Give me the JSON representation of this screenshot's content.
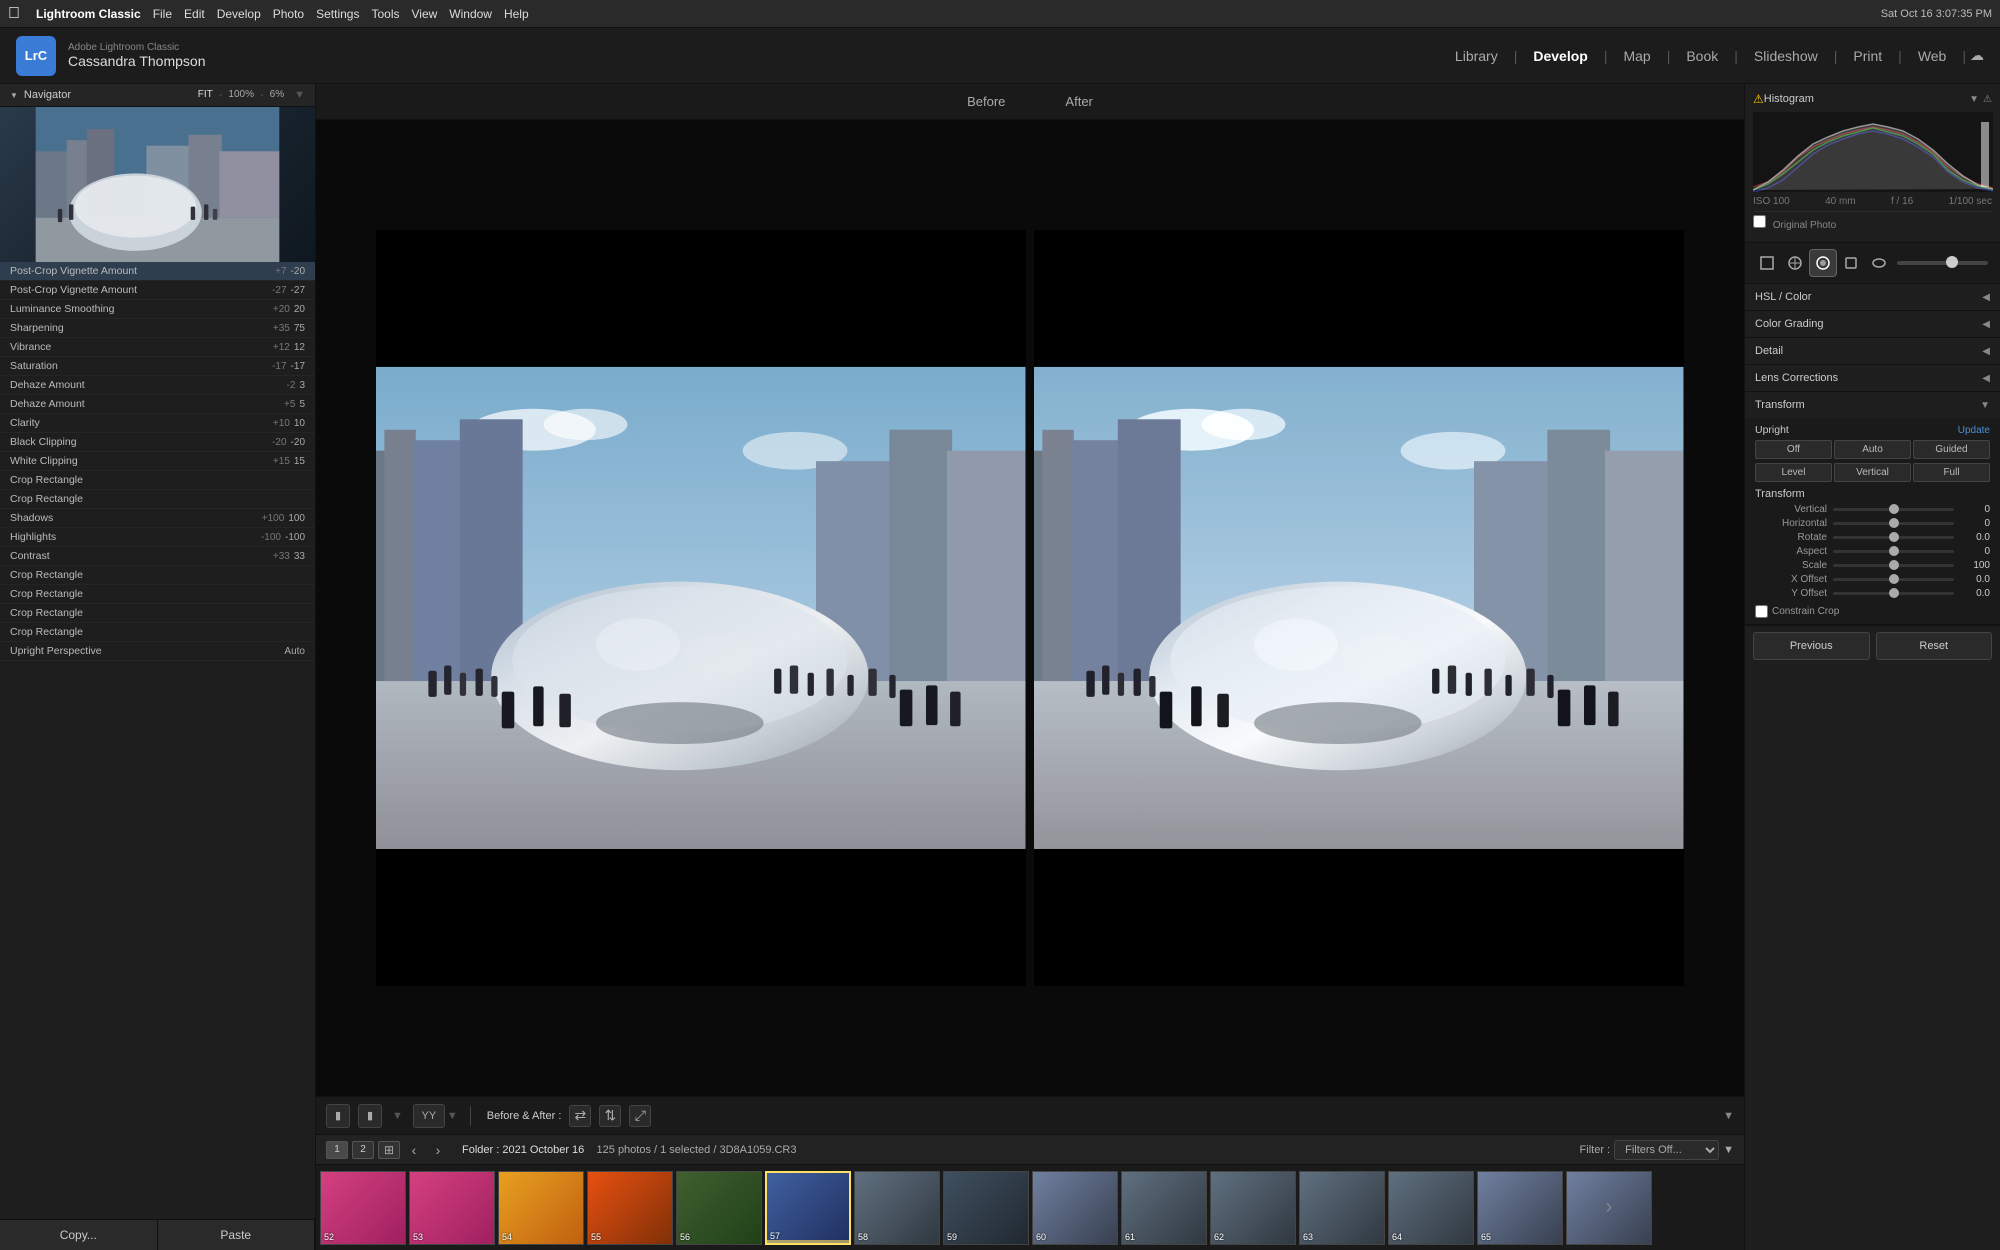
{
  "menubar": {
    "apple": "⌘",
    "items": [
      "Lightroom Classic",
      "File",
      "Edit",
      "Develop",
      "Photo",
      "Settings",
      "Tools",
      "View",
      "Window",
      "Help"
    ],
    "right": "Sat Oct 16  3:07:35 PM"
  },
  "titlebar": {
    "logo": "LrC",
    "app_sub": "Adobe Lightroom Classic",
    "app_user": "Cassandra Thompson",
    "nav_items": [
      "Library",
      "Develop",
      "Map",
      "Book",
      "Slideshow",
      "Print",
      "Web"
    ],
    "active_nav": "Develop"
  },
  "left_panel": {
    "navigator_title": "Navigator",
    "nav_options": [
      "FIT",
      "100%",
      "6%"
    ],
    "active_option": "FIT",
    "copy_label": "Copy...",
    "paste_label": "Paste",
    "history_items": [
      {
        "label": "Post-Crop Vignette Amount",
        "before": "+7",
        "after": "-20"
      },
      {
        "label": "Post-Crop Vignette Amount",
        "before": "-27",
        "after": "-27"
      },
      {
        "label": "Luminance Smoothing",
        "before": "+20",
        "after": "20"
      },
      {
        "label": "Sharpening",
        "before": "+35",
        "after": "75"
      },
      {
        "label": "Vibrance",
        "before": "+12",
        "after": "12"
      },
      {
        "label": "Saturation",
        "before": "-17",
        "after": "-17"
      },
      {
        "label": "Dehaze Amount",
        "before": "-2",
        "after": "3"
      },
      {
        "label": "Dehaze Amount",
        "before": "+5",
        "after": "5"
      },
      {
        "label": "Clarity",
        "before": "+10",
        "after": "10"
      },
      {
        "label": "Black Clipping",
        "before": "-20",
        "after": "-20"
      },
      {
        "label": "White Clipping",
        "before": "+15",
        "after": "15"
      },
      {
        "label": "Crop Rectangle",
        "before": "",
        "after": ""
      },
      {
        "label": "Crop Rectangle",
        "before": "",
        "after": ""
      },
      {
        "label": "Shadows",
        "before": "+100",
        "after": "100"
      },
      {
        "label": "Highlights",
        "before": "-100",
        "after": "-100"
      },
      {
        "label": "Contrast",
        "before": "+33",
        "after": "33"
      },
      {
        "label": "Crop Rectangle",
        "before": "",
        "after": ""
      },
      {
        "label": "Crop Rectangle",
        "before": "",
        "after": ""
      },
      {
        "label": "Crop Rectangle",
        "before": "",
        "after": ""
      },
      {
        "label": "Crop Rectangle",
        "before": "",
        "after": ""
      },
      {
        "label": "Upright Perspective",
        "before": "",
        "after": "Auto"
      }
    ]
  },
  "center": {
    "before_label": "Before",
    "after_label": "After",
    "before_after_label": "Before & After :",
    "toolbar_icons": [
      "◻",
      "◻",
      "YY",
      "⟷",
      "⟷",
      "⤢"
    ]
  },
  "filmstrip": {
    "page_btns": [
      "1",
      "2"
    ],
    "folder_label": "Folder : 2021 October 16",
    "count_label": "125 photos / 1 selected / 3D8A1059.CR3",
    "filter_label": "Filter :",
    "filter_value": "Filters Off...",
    "thumbs": [
      {
        "num": "52",
        "color": "thumb-pink"
      },
      {
        "num": "53",
        "color": "thumb-pink"
      },
      {
        "num": "54",
        "color": "thumb-flowers"
      },
      {
        "num": "55",
        "color": "thumb-orange"
      },
      {
        "num": "56",
        "color": "thumb-green"
      },
      {
        "num": "57",
        "color": "thumb-city",
        "selected": true
      },
      {
        "num": "58",
        "color": "thumb-bean"
      },
      {
        "num": "59",
        "color": "thumb-people"
      },
      {
        "num": "60",
        "color": "thumb-gray"
      },
      {
        "num": "61",
        "color": "thumb-bean"
      },
      {
        "num": "62",
        "color": "thumb-bean"
      },
      {
        "num": "63",
        "color": "thumb-bean"
      },
      {
        "num": "64",
        "color": "thumb-bean"
      },
      {
        "num": "65",
        "color": "thumb-gray"
      },
      {
        "num": "→",
        "color": "thumb-gray"
      }
    ]
  },
  "right_panel": {
    "histogram_title": "Histogram",
    "iso": "ISO 100",
    "focal": "40 mm",
    "aperture": "f / 16",
    "shutter": "1/100 sec",
    "orig_photo": "Original Photo",
    "panels": [
      {
        "title": "HSL / Color",
        "arrow": "◀"
      },
      {
        "title": "Color Grading",
        "arrow": "◀"
      },
      {
        "title": "Detail",
        "arrow": "◀"
      },
      {
        "title": "Lens Corrections",
        "arrow": "◀"
      },
      {
        "title": "Transform",
        "arrow": "▼",
        "expanded": true
      }
    ],
    "transform": {
      "upright_label": "Upright",
      "update_label": "Update",
      "btns": [
        "Off",
        "Auto",
        "Guided"
      ],
      "btns2": [
        "Level",
        "Vertical",
        "Full"
      ],
      "section_title": "Transform",
      "rows": [
        {
          "label": "Vertical",
          "value": "0",
          "pct": 50
        },
        {
          "label": "Horizontal",
          "value": "0",
          "pct": 50
        },
        {
          "label": "Rotate",
          "value": "0.0",
          "pct": 50
        },
        {
          "label": "Aspect",
          "value": "0",
          "pct": 50
        },
        {
          "label": "Scale",
          "value": "100",
          "pct": 50
        },
        {
          "label": "X Offset",
          "value": "0.0",
          "pct": 50
        },
        {
          "label": "Y Offset",
          "value": "0.0",
          "pct": 50
        }
      ],
      "constrain_crop": "Constrain Crop"
    },
    "prev_label": "Previous",
    "reset_label": "Reset"
  }
}
